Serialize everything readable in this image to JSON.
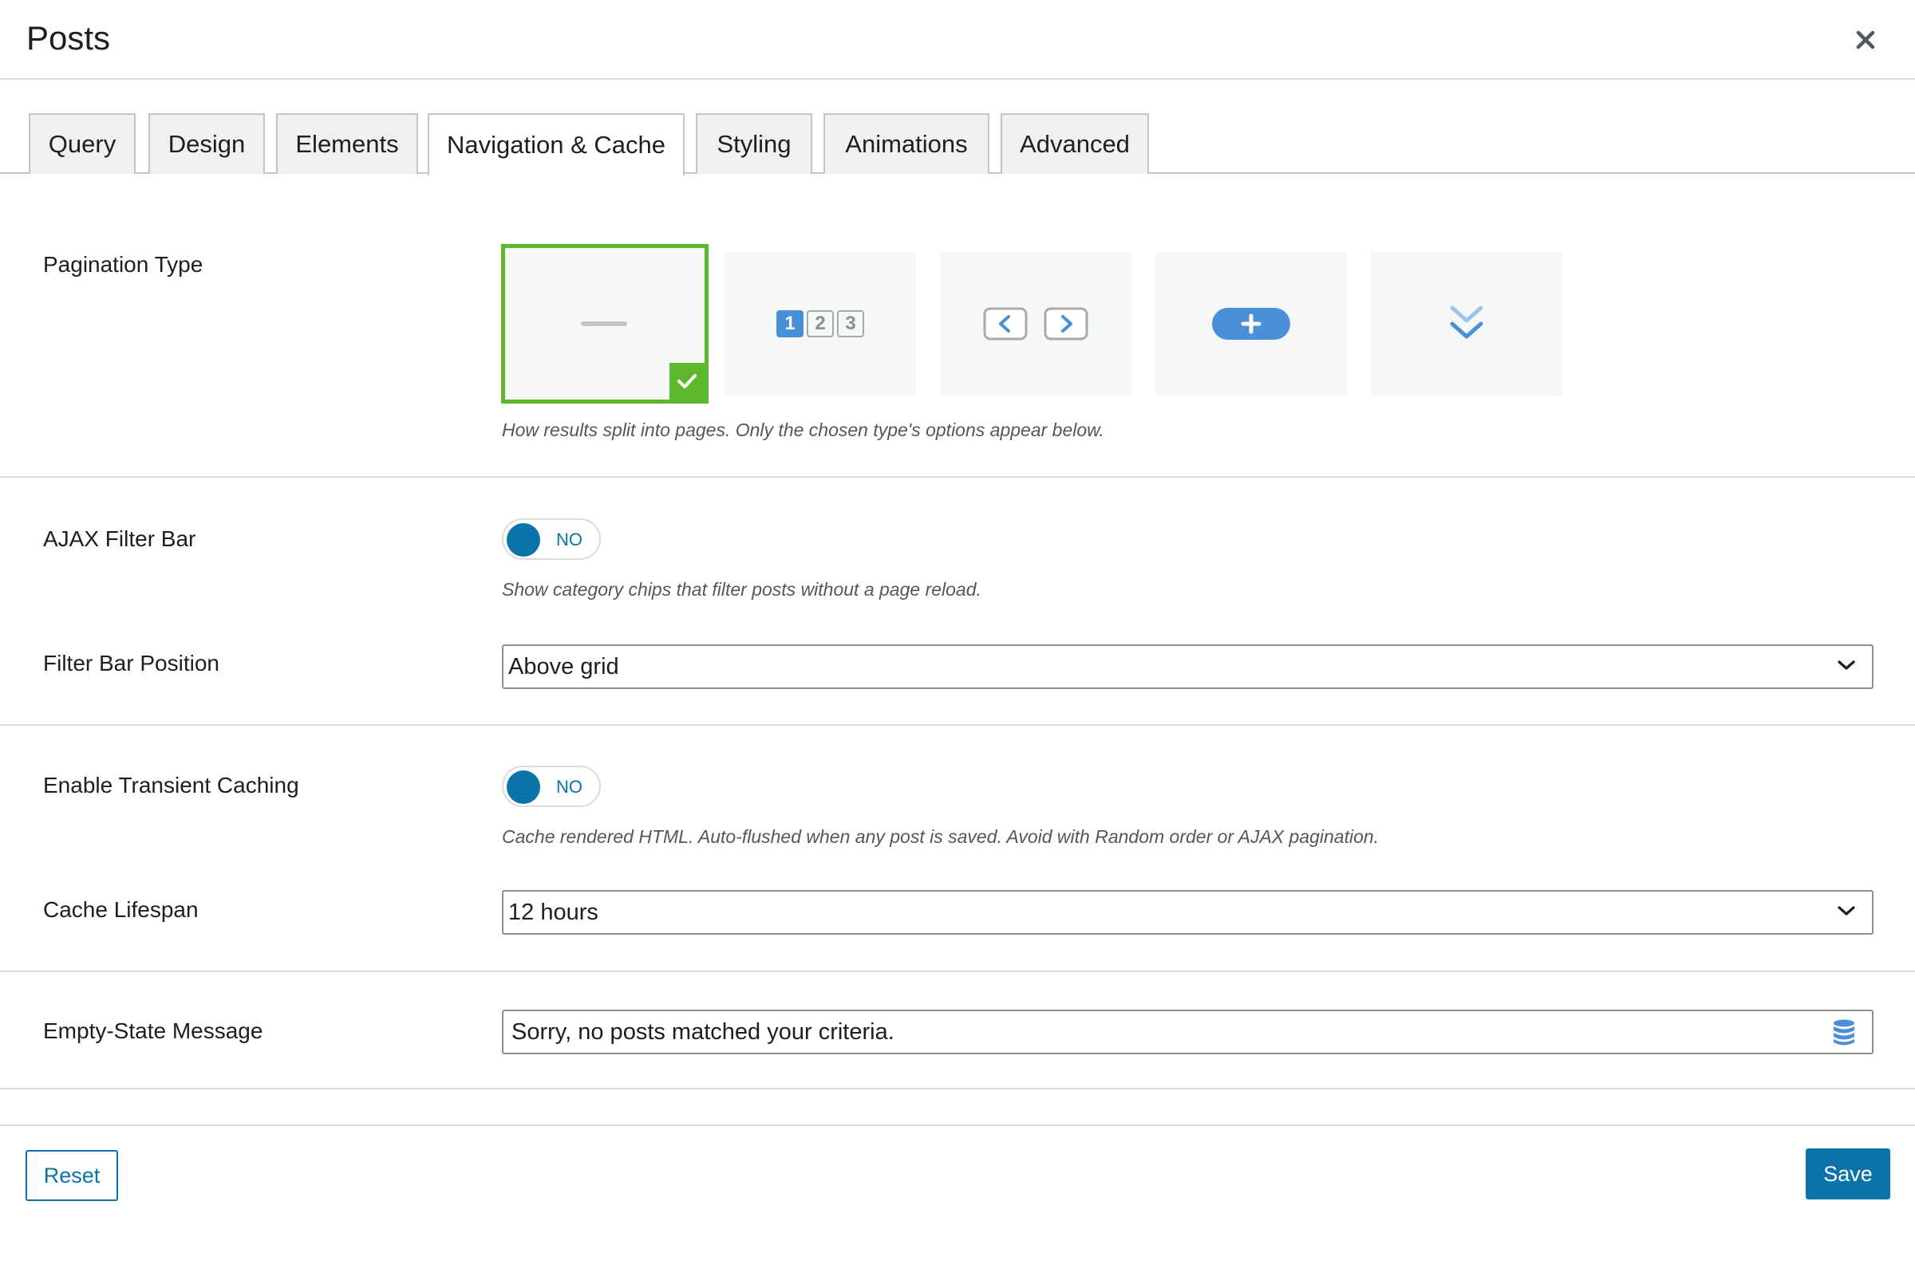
{
  "header": {
    "title": "Posts"
  },
  "tabs": [
    {
      "label": "Query",
      "active": false
    },
    {
      "label": "Design",
      "active": false
    },
    {
      "label": "Elements",
      "active": false
    },
    {
      "label": "Navigation & Cache",
      "active": true
    },
    {
      "label": "Styling",
      "active": false
    },
    {
      "label": "Animations",
      "active": false
    },
    {
      "label": "Advanced",
      "active": false
    }
  ],
  "pagination": {
    "label": "Pagination Type",
    "description": "How results split into pages. Only the chosen type's options appear below.",
    "options": [
      {
        "id": "none",
        "icon": "dash-icon",
        "selected": true
      },
      {
        "id": "numbers",
        "icon": "page-numbers-icon",
        "digits": [
          "1",
          "2",
          "3"
        ],
        "selected": false
      },
      {
        "id": "prev-next",
        "icon": "prev-next-arrows-icon",
        "selected": false
      },
      {
        "id": "load-more",
        "icon": "load-more-plus-icon",
        "selected": false
      },
      {
        "id": "infinite",
        "icon": "double-chevron-down-icon",
        "selected": false
      }
    ]
  },
  "ajax_filter": {
    "label": "AJAX Filter Bar",
    "toggle": "NO",
    "description": "Show category chips that filter posts without a page reload."
  },
  "filter_position": {
    "label": "Filter Bar Position",
    "value": "Above grid"
  },
  "transient_cache": {
    "label": "Enable Transient Caching",
    "toggle": "NO",
    "description": "Cache rendered HTML. Auto-flushed when any post is saved. Avoid with Random order or AJAX pagination."
  },
  "cache_lifespan": {
    "label": "Cache Lifespan",
    "value": "12 hours"
  },
  "empty_state": {
    "label": "Empty-State Message",
    "value": "Sorry, no posts matched your criteria."
  },
  "footer": {
    "reset_label": "Reset",
    "save_label": "Save"
  },
  "colors": {
    "accent": "#0a73aa",
    "selected_border": "#5cb82a",
    "icon_blue": "#4a90d9"
  }
}
